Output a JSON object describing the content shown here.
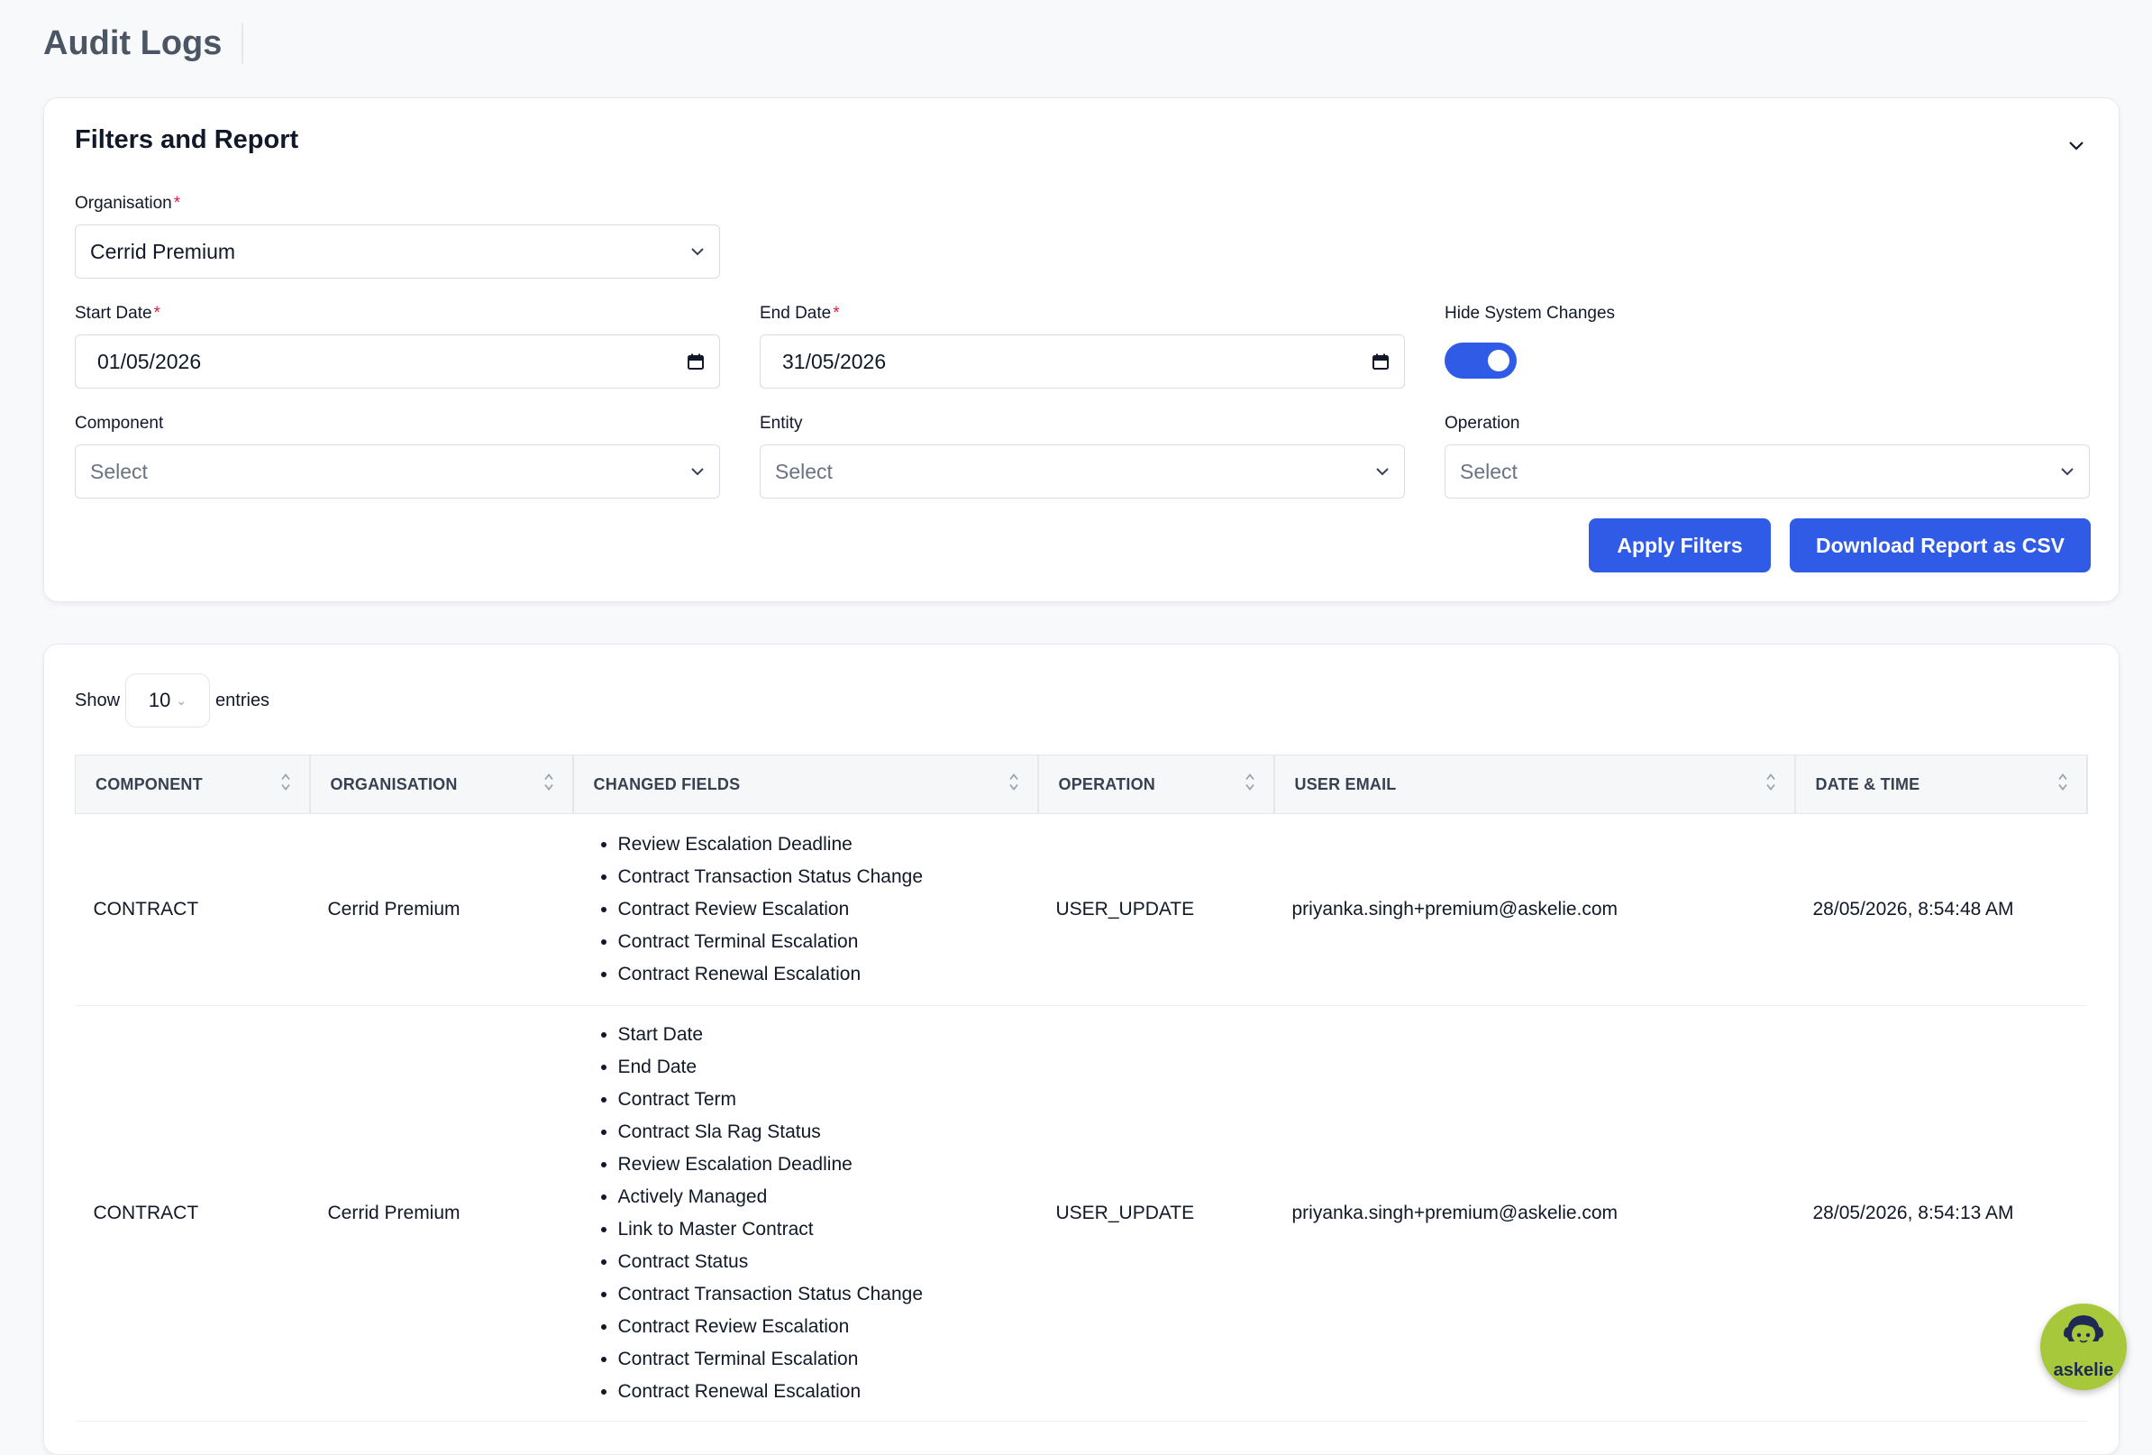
{
  "page": {
    "title": "Audit Logs"
  },
  "filters": {
    "title": "Filters and Report",
    "organisation": {
      "label": "Organisation",
      "required_mark": "*",
      "value": "Cerrid Premium"
    },
    "start_date": {
      "label": "Start Date",
      "required_mark": "*",
      "value": "01/05/2026"
    },
    "end_date": {
      "label": "End Date",
      "required_mark": "*",
      "value": "31/05/2026"
    },
    "hide_system_changes": {
      "label": "Hide System Changes",
      "checked": true
    },
    "component": {
      "label": "Component",
      "placeholder": "Select"
    },
    "entity": {
      "label": "Entity",
      "placeholder": "Select"
    },
    "operation": {
      "label": "Operation",
      "placeholder": "Select"
    },
    "apply_label": "Apply Filters",
    "download_label": "Download Report as CSV",
    "accent_color": "#2f5be7"
  },
  "table": {
    "show_label": "Show",
    "page_size": "10",
    "entries_label": "entries",
    "headers": [
      "COMPONENT",
      "ORGANISATION",
      "CHANGED FIELDS",
      "OPERATION",
      "USER EMAIL",
      "DATE & TIME"
    ],
    "rows": [
      {
        "component": "CONTRACT",
        "organisation": "Cerrid Premium",
        "changed_fields": [
          "Review Escalation Deadline",
          "Contract Transaction Status Change",
          "Contract Review Escalation",
          "Contract Terminal Escalation",
          "Contract Renewal Escalation"
        ],
        "operation": "USER_UPDATE",
        "user_email": "priyanka.singh+premium@askelie.com",
        "datetime": "28/05/2026, 8:54:48 AM"
      },
      {
        "component": "CONTRACT",
        "organisation": "Cerrid Premium",
        "changed_fields": [
          "Start Date",
          "End Date",
          "Contract Term",
          "Contract Sla Rag Status",
          "Review Escalation Deadline",
          "Actively Managed",
          "Link to Master Contract",
          "Contract Status",
          "Contract Transaction Status Change",
          "Contract Review Escalation",
          "Contract Terminal Escalation",
          "Contract Renewal Escalation"
        ],
        "operation": "USER_UPDATE",
        "user_email": "priyanka.singh+premium@askelie.com",
        "datetime": "28/05/2026, 8:54:13 AM"
      }
    ]
  },
  "chat_widget": {
    "label": "askelie",
    "icon": "assistant-avatar-icon"
  }
}
